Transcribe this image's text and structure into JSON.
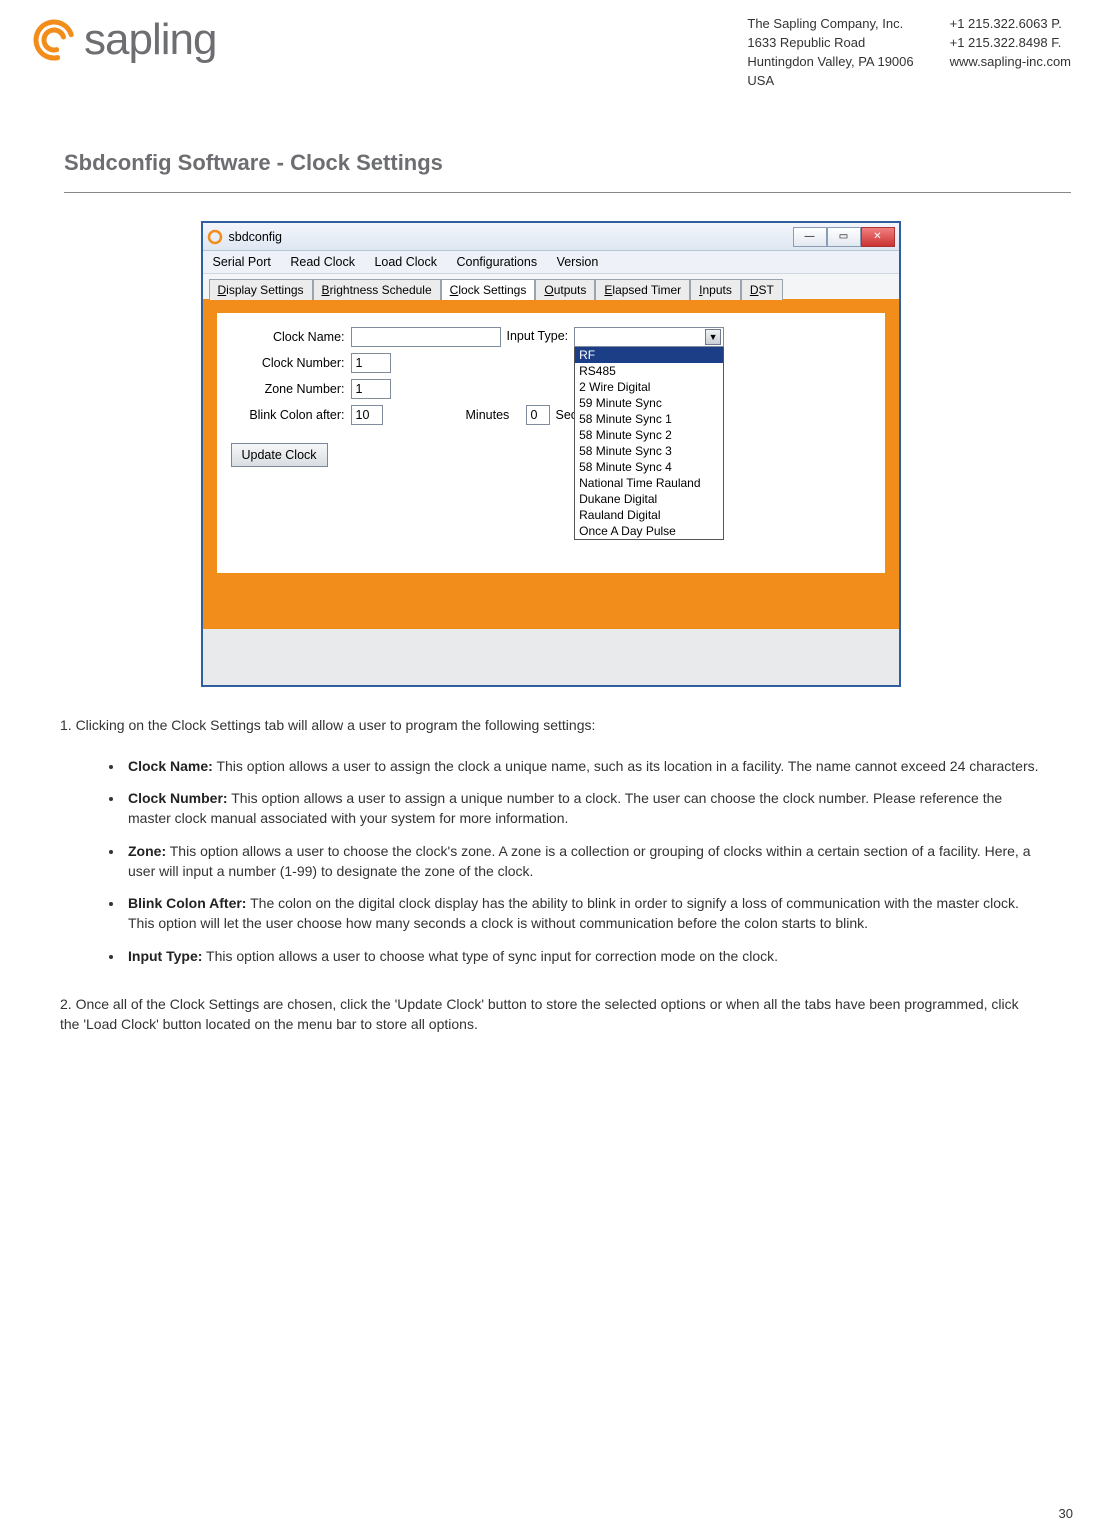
{
  "header": {
    "logo_text": "sapling",
    "address": {
      "line1": "The Sapling Company, Inc.",
      "line2": "1633 Republic Road",
      "line3": "Huntingdon Valley, PA 19006",
      "line4": "USA"
    },
    "contact": {
      "phone": "+1 215.322.6063 P.",
      "fax": "+1 215.322.8498 F.",
      "web": "www.sapling-inc.com"
    }
  },
  "section_title": "Sbdconfig Software - Clock Settings",
  "window": {
    "title": "sbdconfig",
    "menu": [
      "Serial Port",
      "Read Clock",
      "Load Clock",
      "Configurations",
      "Version"
    ],
    "tabs": [
      "Display Settings",
      "Brightness Schedule",
      "Clock Settings",
      "Outputs",
      "Elapsed Timer",
      "Inputs",
      "DST"
    ],
    "tabs_underline_first": [
      "D",
      "B",
      "C",
      "O",
      "E",
      "I",
      "D"
    ],
    "active_tab_index": 2,
    "form": {
      "clock_name_label": "Clock Name:",
      "clock_name_value": "",
      "clock_number_label": "Clock Number:",
      "clock_number_value": "1",
      "zone_number_label": "Zone Number:",
      "zone_number_value": "1",
      "blink_label": "Blink Colon after:",
      "blink_min_value": "10",
      "blink_min_unit": "Minutes",
      "blink_sec_value": "0",
      "blink_sec_unit": "Seconds",
      "update_btn": "Update Clock",
      "input_type_label": "Input Type:",
      "input_type_options": [
        "RF",
        "RS485",
        "2 Wire Digital",
        "59 Minute Sync",
        "58 Minute Sync 1",
        "58 Minute Sync 2",
        "58 Minute Sync 3",
        "58 Minute Sync 4",
        "National Time Rauland",
        "Dukane Digital",
        "Rauland Digital",
        "Once A Day Pulse"
      ],
      "input_type_selected_index": 0
    }
  },
  "content": {
    "intro": "1. Clicking on the Clock Settings tab will allow a user to program the following settings:",
    "bullets": [
      {
        "title": "Clock Name:",
        "text": " This option allows a user to assign the clock a unique name, such as its location in a facility. The name cannot exceed 24 characters."
      },
      {
        "title": "Clock Number:",
        "text": " This option allows a user to assign a unique number to a clock. The user can choose the clock number. Please reference the master clock manual associated with your system for more information."
      },
      {
        "title": "Zone:",
        "text": " This option allows a user to choose the clock's zone. A zone is a collection or grouping of clocks within a certain section of a facility. Here, a user will input a number (1-99) to designate the zone of the clock."
      },
      {
        "title": "Blink Colon After:",
        "text": " The colon on the digital clock display has the ability to blink in order to signify a loss of communication with the master clock. This option will let the user choose how many seconds a clock is without communication before the colon starts to blink."
      },
      {
        "title": "Input Type:",
        "text": " This option allows a user to choose what type of sync input for correction mode on the clock."
      }
    ],
    "para2": "2. Once all of the Clock Settings are chosen, click the 'Update Clock' button to store the selected options or when all the tabs have been programmed, click the 'Load Clock' button located on the menu bar to store all options."
  },
  "page_number": "30"
}
